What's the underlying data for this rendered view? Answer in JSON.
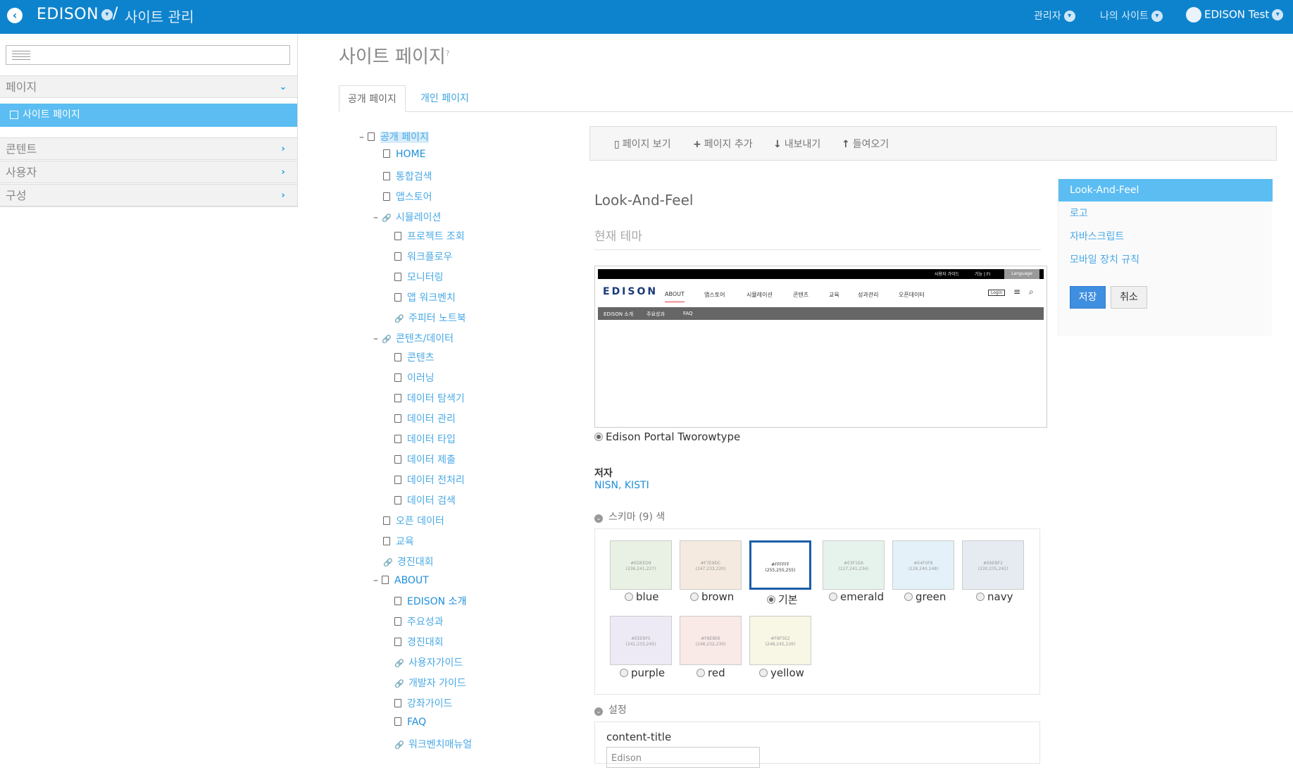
{
  "topbar": {
    "brand": "EDISON",
    "separator": "/",
    "crumb": "사이트 관리",
    "nav_admin": "관리자",
    "nav_mysites": "나의 사이트",
    "user": "EDISON Test"
  },
  "sidebar": {
    "sections": [
      {
        "label": "페이지"
      },
      {
        "label": "콘텐트"
      },
      {
        "label": "사용자"
      },
      {
        "label": "구성"
      }
    ],
    "active_item": "사이트 페이지"
  },
  "main": {
    "title": "사이트 페이지",
    "tabs": [
      "공개 페이지",
      "개인 페이지"
    ]
  },
  "tree": {
    "nodes": [
      "공개 페이지",
      "HOME",
      "통합검색",
      "앱스토어",
      "시뮬레이션",
      "프로젝트 조회",
      "워크플로우",
      "모니터링",
      "앱 워크벤치",
      "주피터 노트북",
      "콘텐츠/데이터",
      "콘텐츠",
      "이러닝",
      "데이터 탐색기",
      "데이터 관리",
      "데이터 타입",
      "데이터 제출",
      "데이터 전처리",
      "데이터 검색",
      "오픈 데이터",
      "교육",
      "경진대회",
      "ABOUT",
      "EDISON 소개",
      "주요성과",
      "경진대회",
      "사용자가이드",
      "개발자 가이드",
      "강좌가이드",
      "FAQ",
      "워크벤치매뉴얼"
    ]
  },
  "toolbar": {
    "view": "페이지 보기",
    "add": "페이지 추가",
    "export": "내보내기",
    "import": "들여오기"
  },
  "laf": {
    "title": "Look-And-Feel",
    "current_theme": "현재 테마",
    "theme_name": "Edison Portal Tworowtype",
    "author_label": "저자",
    "author_value": "NISN, KISTI",
    "schema_label": "스키마 (9) 색",
    "settings_label": "설정",
    "content_title_label": "content-title",
    "content_title_value": "Edison"
  },
  "preview": {
    "top_links": [
      "사용자 가이드",
      "기능 | FI",
      "Language"
    ],
    "logo": "EDISON",
    "menu": [
      "ABOUT",
      "앱스토어",
      "시뮬레이션",
      "콘텐츠",
      "교육",
      "성과관리",
      "오픈데이터"
    ],
    "login": "Login",
    "sub": [
      "EDISON 소개",
      "주요성과",
      "FAQ"
    ]
  },
  "schemes": [
    {
      "label": "blue",
      "hex": "#e9f1e4",
      "code": "#EDEED9\n(236,241,227)"
    },
    {
      "label": "brown",
      "hex": "#f4eadf",
      "code": "#F7E9DC\n(247,233,220)"
    },
    {
      "label": "기본",
      "hex": "#ffffff",
      "code": "#FFFFFF\n(255,255,255)",
      "selected": true
    },
    {
      "label": "emerald",
      "hex": "#e6f3ec",
      "code": "#E3F1EA\n(227,241,234)"
    },
    {
      "label": "green",
      "hex": "#e4f1f8",
      "code": "#E4F0F8\n(228,240,248)"
    },
    {
      "label": "navy",
      "hex": "#e6ebf2",
      "code": "#E6EBF2\n(230,235,242)"
    },
    {
      "label": "purple",
      "hex": "#eeeaf5",
      "code": "#EEE9F5\n(241,233,245)"
    },
    {
      "label": "red",
      "hex": "#f9e9e7",
      "code": "#F8E8E6\n(248,232,230)"
    },
    {
      "label": "yellow",
      "hex": "#f8f6e4",
      "code": "#F8F5E2\n(248,245,226)"
    }
  ],
  "right_panel": {
    "items": [
      "Look-And-Feel",
      "로고",
      "자바스크립트",
      "모바일 장치 규칙"
    ],
    "save": "저장",
    "cancel": "취소"
  }
}
